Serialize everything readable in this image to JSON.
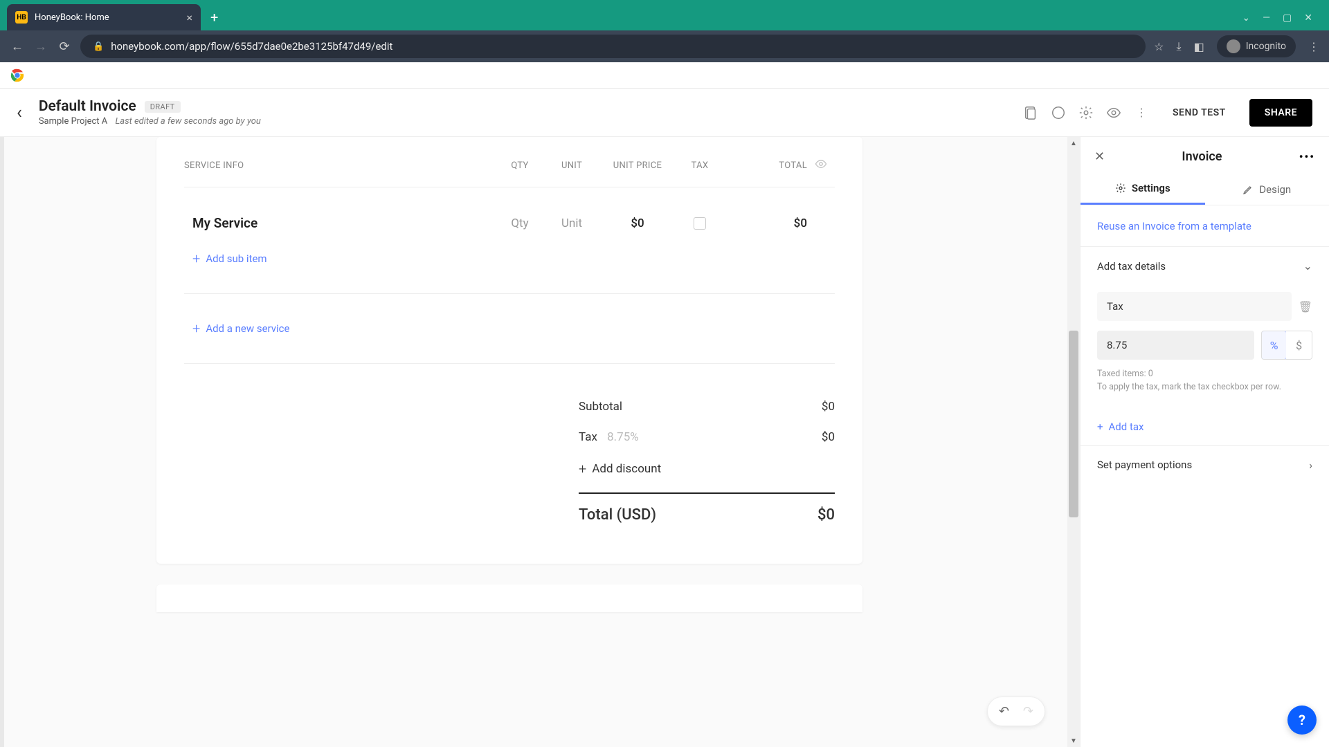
{
  "browser": {
    "tab_title": "HoneyBook: Home",
    "favicon_text": "HB",
    "url": "honeybook.com/app/flow/655d7dae0e2be3125bf47d49/edit",
    "incognito_label": "Incognito"
  },
  "header": {
    "title": "Default Invoice",
    "badge": "DRAFT",
    "project": "Sample Project A",
    "last_edited": "Last edited a few seconds ago by you",
    "send_test": "SEND TEST",
    "share": "SHARE"
  },
  "invoice": {
    "columns": {
      "service": "SERVICE INFO",
      "qty": "QTY",
      "unit": "UNIT",
      "price": "UNIT PRICE",
      "tax": "TAX",
      "total": "TOTAL"
    },
    "item": {
      "name": "My Service",
      "qty": "Qty",
      "unit": "Unit",
      "price": "$0",
      "total": "$0"
    },
    "add_sub_item": "Add sub item",
    "add_service": "Add a new service",
    "totals": {
      "subtotal_label": "Subtotal",
      "subtotal_value": "$0",
      "tax_label": "Tax",
      "tax_percent": "8.75%",
      "tax_value": "$0",
      "add_discount": "Add discount",
      "grand_label": "Total (USD)",
      "grand_value": "$0"
    }
  },
  "panel": {
    "title": "Invoice",
    "tab_settings": "Settings",
    "tab_design": "Design",
    "reuse_link": "Reuse an Invoice from a template",
    "tax_section_label": "Add tax details",
    "tax_name": "Tax",
    "tax_value": "8.75",
    "unit_percent": "%",
    "unit_dollar": "$",
    "taxed_items": "Taxed items: 0",
    "tax_hint": "To apply the tax, mark the tax checkbox per row.",
    "add_tax": "Add tax",
    "payment_options": "Set payment options"
  },
  "help": "?"
}
